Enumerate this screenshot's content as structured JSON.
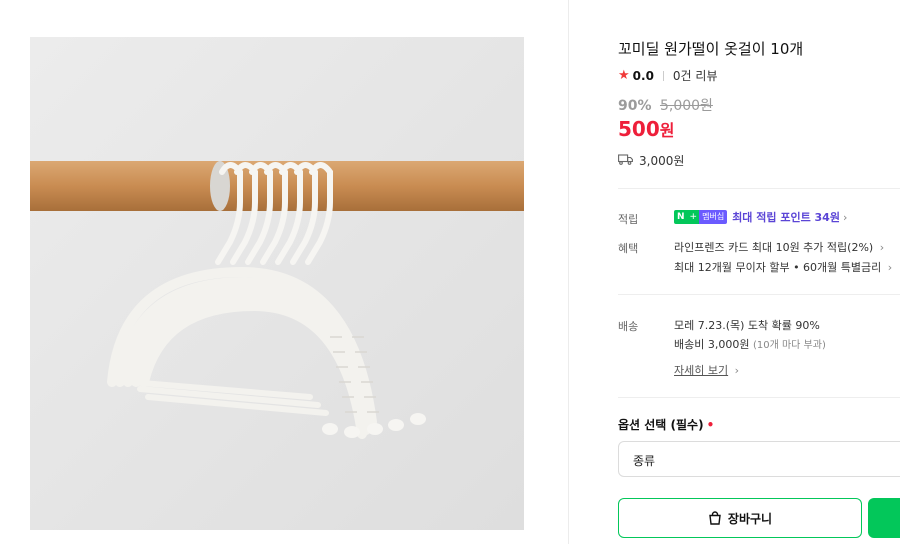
{
  "product": {
    "title": "꼬미딜 원가떨이 옷걸이 10개",
    "rating": "0.0",
    "reviews": "0건 리뷰",
    "discount": "90%",
    "original_price": "5,000원",
    "price_number": "500",
    "price_unit": "원",
    "shipping_fee": "3,000원"
  },
  "benefits": {
    "points_label": "적립",
    "badge_n": "N",
    "badge_plus": "+",
    "badge_member": "멤버십",
    "points_text": "최대 적립 포인트 34원",
    "benefit_label": "혜택",
    "benefit_line1": "라인프렌즈 카드 최대 10원 추가 적립(2%)",
    "benefit_line2": "최대 12개월 무이자 할부 • 60개월 특별금리"
  },
  "delivery": {
    "label": "배송",
    "arrival": "모레 7.23.(목) 도착 확률 90%",
    "fee": "배송비 3,000원",
    "fee_note": "(10개 마다 부과)",
    "more_link": "자세히 보기"
  },
  "options": {
    "title": "옵션 선택 (필수)",
    "required_mark": "•",
    "select_label": "종류"
  },
  "actions": {
    "cart_label": "장바구니"
  },
  "icons": {
    "star": "star-icon",
    "truck": "truck-icon",
    "chevron": "chevron-right-icon",
    "bag": "shopping-bag-icon"
  },
  "colors": {
    "price_red": "#ee1f3a",
    "naver_green": "#03c75a",
    "points_purple": "#5b45d6"
  }
}
